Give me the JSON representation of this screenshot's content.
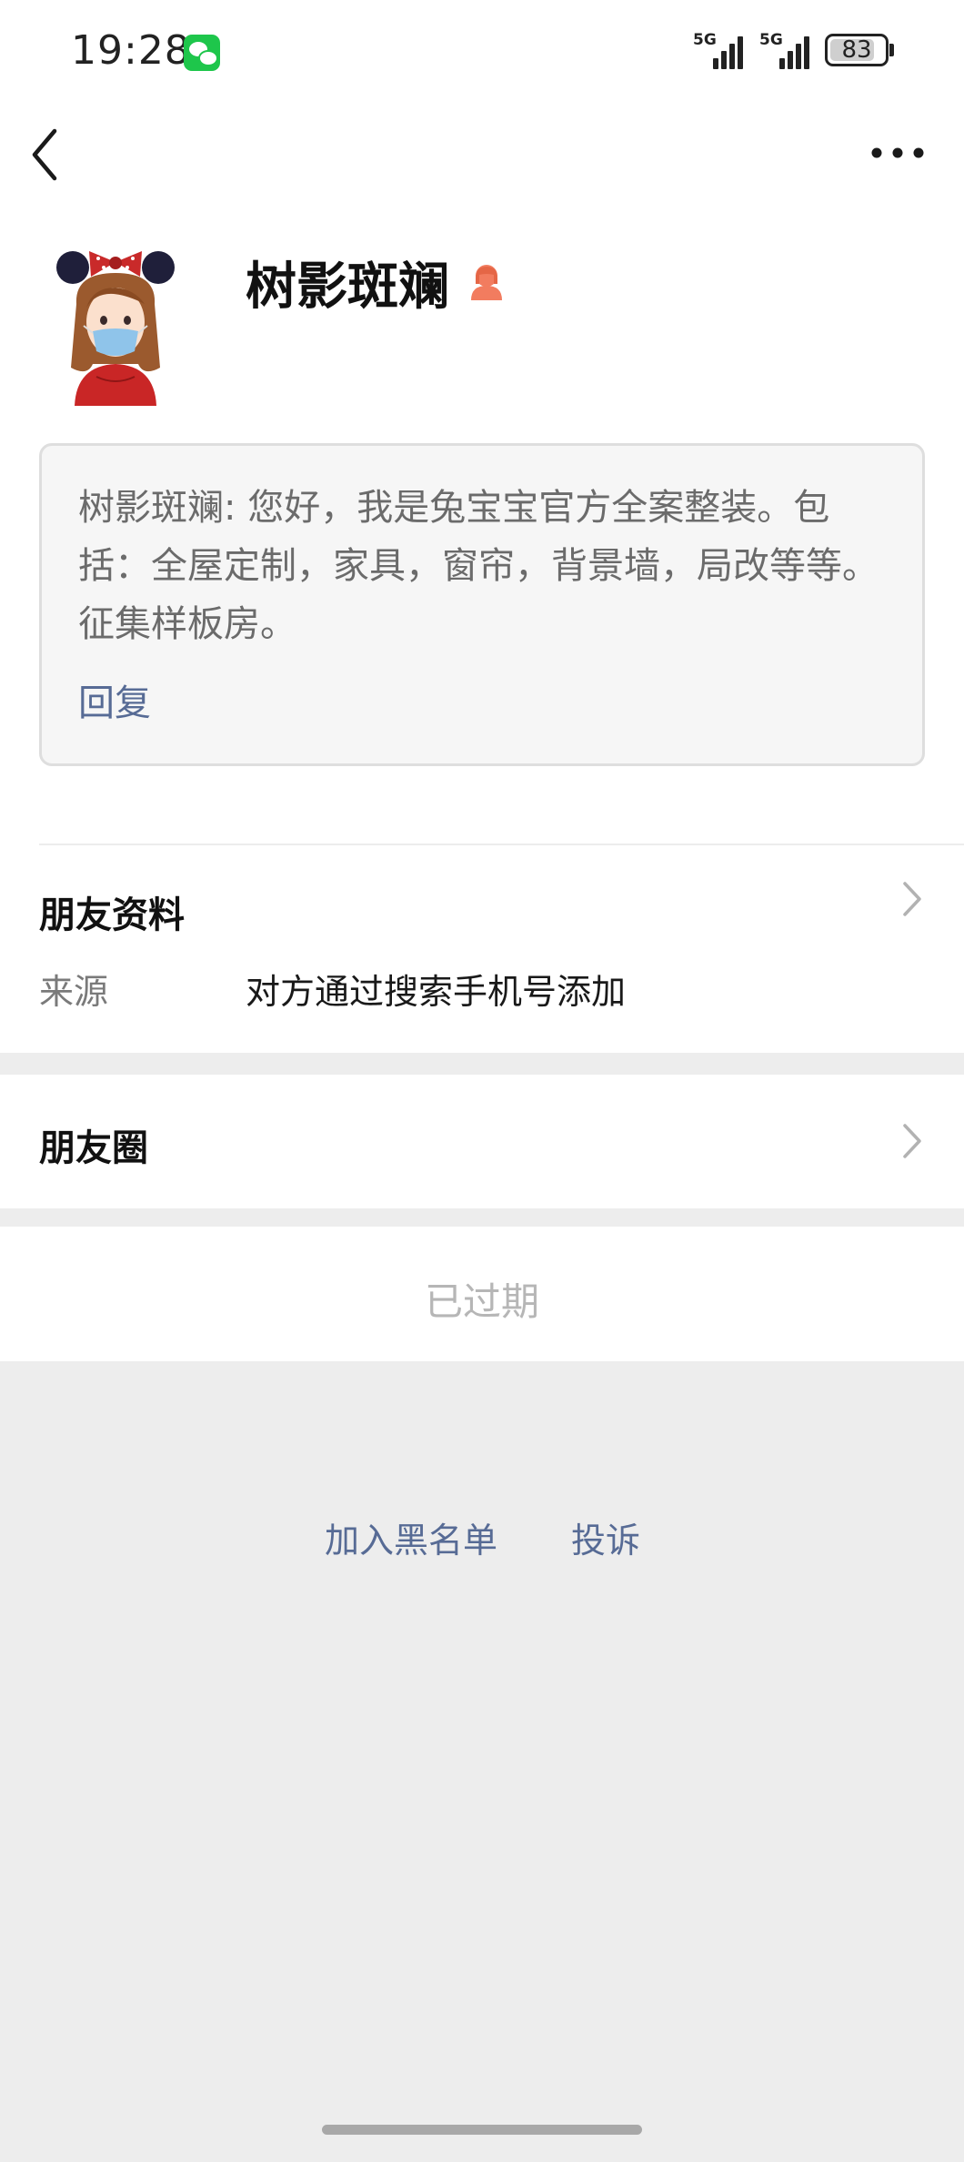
{
  "status_bar": {
    "time": "19:28",
    "app_badge": "wechat-icon",
    "signal1_label": "5G",
    "signal2_label": "5G",
    "battery_level": 83,
    "battery_text": "83"
  },
  "nav": {
    "back_icon": "back-chevron-icon",
    "more_icon": "more-dots-icon"
  },
  "profile": {
    "name": "树影斑斓",
    "gender_icon": "female-icon",
    "gender_color": "#f27c5f"
  },
  "greeting": {
    "message": "树影斑斓: 您好，我是兔宝宝官方全案整装。包括：全屋定制，家具，窗帘，背景墙，局改等等。征集样板房。",
    "reply_label": "回复"
  },
  "friend_info": {
    "title": "朋友资料",
    "source_label": "来源",
    "source_value": "对方通过搜索手机号添加"
  },
  "moments": {
    "title": "朋友圈"
  },
  "status": {
    "expired_label": "已过期"
  },
  "footer": {
    "blacklist_label": "加入黑名单",
    "report_label": "投诉"
  },
  "colors": {
    "link": "#576b95",
    "background": "#ededed",
    "wechat_green": "#1ec64b"
  }
}
